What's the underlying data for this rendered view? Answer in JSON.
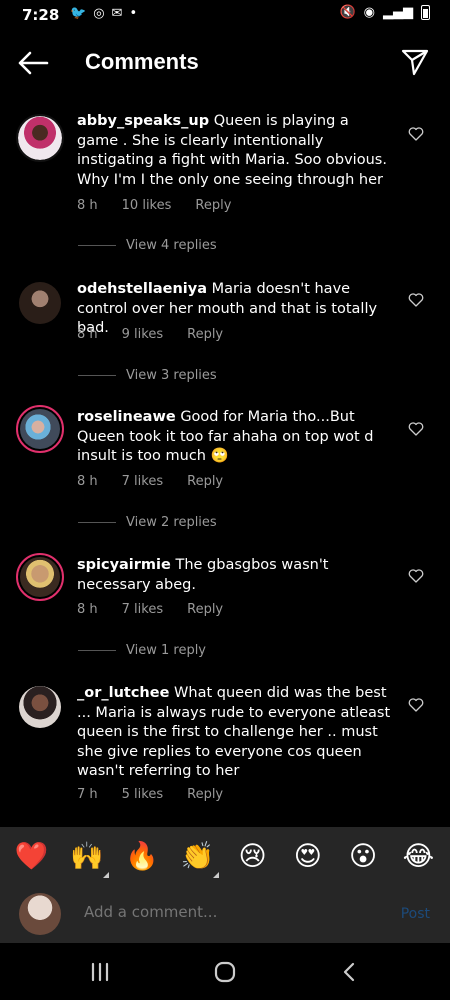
{
  "status_bar": {
    "time": "7:28"
  },
  "header": {
    "title": "Comments"
  },
  "comments": [
    {
      "user": "abby_speaks_up",
      "text": "Queen is playing a game . She is clearly intentionally instigating a fight with Maria. Soo obvious. Why I'm I the only one seeing through her",
      "time": "8 h",
      "likes": "10 likes",
      "reply": "Reply",
      "replies_link": "View 4 replies"
    },
    {
      "user": "odehstellaeniya",
      "text": "Maria doesn't have control over her mouth and that is totally bad.",
      "time": "8 h",
      "likes": "9 likes",
      "reply": "Reply",
      "replies_link": "View 3 replies"
    },
    {
      "user": "roselineawe",
      "text": "Good for Maria tho...But Queen took it too far ahaha on top wot d insult is too much 🙄",
      "time": "8 h",
      "likes": "7 likes",
      "reply": "Reply",
      "replies_link": "View 2 replies"
    },
    {
      "user": "spicyairmie",
      "text": "The gbasgbos wasn't necessary abeg.",
      "time": "8 h",
      "likes": "7 likes",
      "reply": "Reply",
      "replies_link": "View 1 reply"
    },
    {
      "user": "_or_lutchee",
      "text": "What queen did was the best ... Maria is always rude to everyone atleast queen is the first to challenge her .. must she give replies to everyone cos queen wasn't referring to her",
      "time": "7 h",
      "likes": "5 likes",
      "reply": "Reply"
    }
  ],
  "emoji_bar": [
    "❤️",
    "🙌",
    "🔥",
    "👏",
    "😢",
    "😍",
    "😮",
    "😂"
  ],
  "input": {
    "placeholder": "Add a comment...",
    "post_label": "Post"
  }
}
